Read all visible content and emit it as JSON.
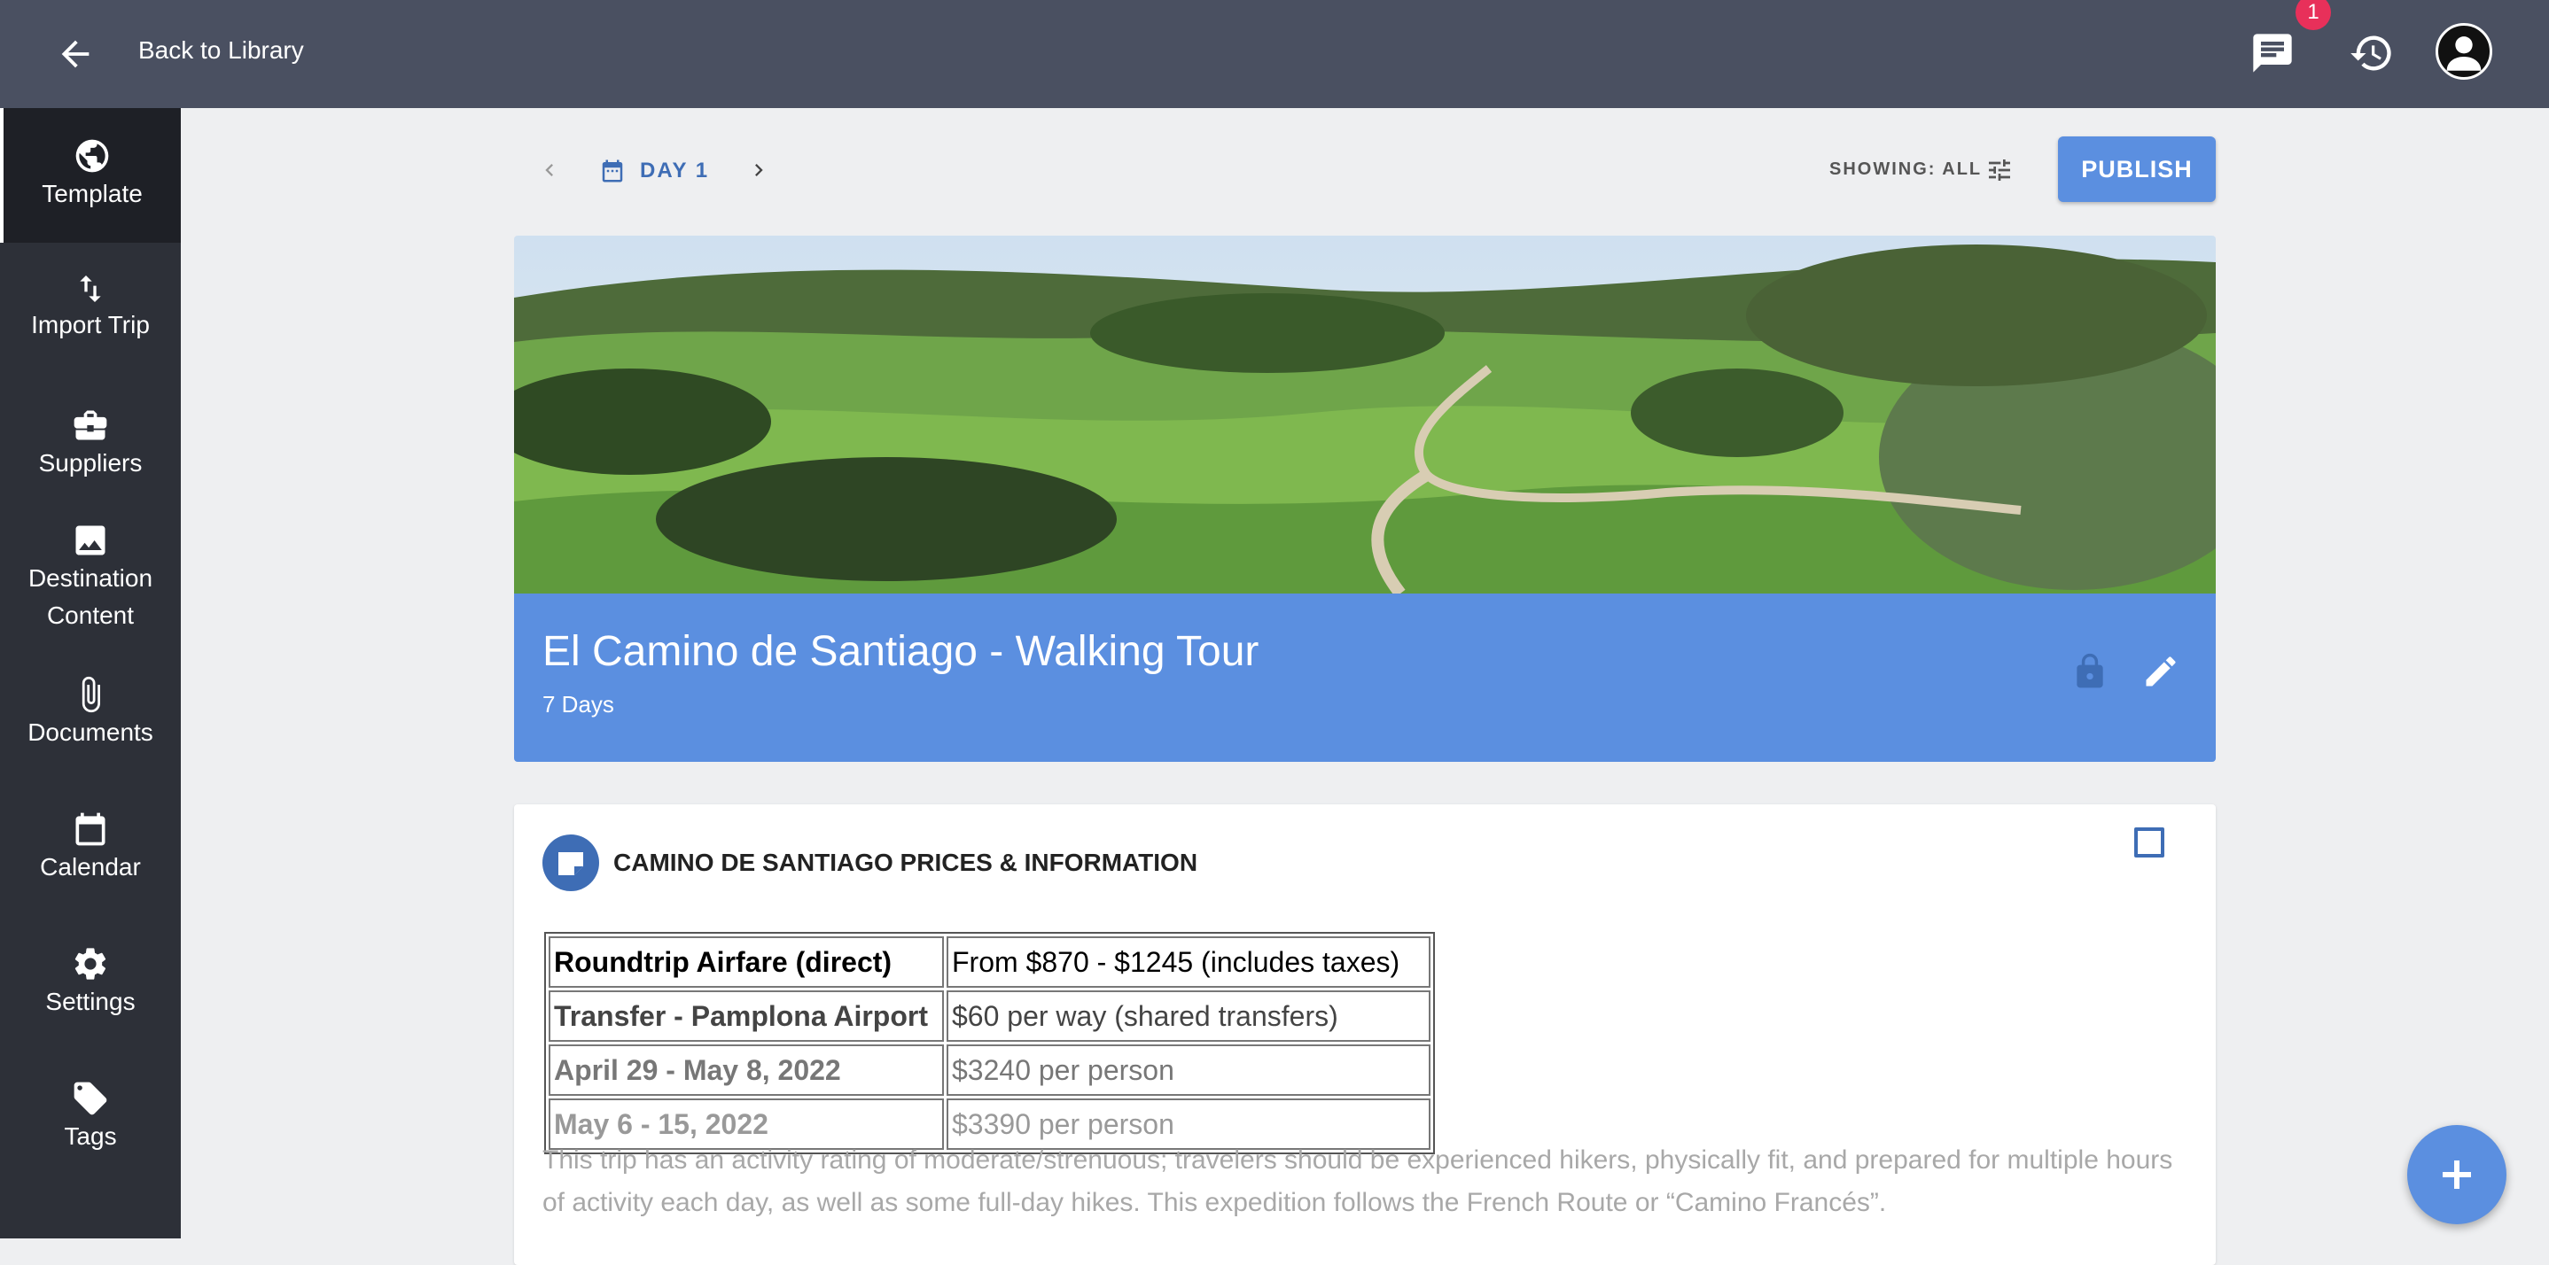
{
  "topbar": {
    "back_label": "Back to Library",
    "notification_count": "1"
  },
  "sidebar": {
    "items": [
      {
        "label": "Template",
        "icon": "globe-icon"
      },
      {
        "label": "Import Trip",
        "icon": "import-icon"
      },
      {
        "label": "Suppliers",
        "icon": "briefcase-icon"
      },
      {
        "label": "Destination",
        "label2": "Content",
        "icon": "image-icon"
      },
      {
        "label": "Documents",
        "icon": "paperclip-icon"
      },
      {
        "label": "Calendar",
        "icon": "calendar-icon"
      },
      {
        "label": "Settings",
        "icon": "gear-icon"
      },
      {
        "label": "Tags",
        "icon": "tag-icon"
      }
    ]
  },
  "toolbar": {
    "day_label": "DAY 1",
    "showing_label": "SHOWING: ALL",
    "publish_label": "PUBLISH"
  },
  "hero": {
    "title": "El Camino de Santiago - Walking Tour",
    "duration": "7 Days"
  },
  "card": {
    "title": "CAMINO DE SANTIAGO PRICES & INFORMATION",
    "table": [
      [
        "Roundtrip Airfare (direct)",
        "From $870 - $1245 (includes taxes)"
      ],
      [
        "Transfer - Pamplona Airport",
        "$60 per way (shared transfers)"
      ],
      [
        "April 29 - May 8, 2022",
        "$3240 per person"
      ],
      [
        "May 6 - 15, 2022",
        "$3390 per person"
      ]
    ],
    "description": "This trip has an activity rating of moderate/strenuous; travelers should be experienced hikers, physically fit, and prepared for multiple hours of activity each day, as well as some full-day hikes. This expedition follows the French Route or “Camino Francés”."
  },
  "colors": {
    "topbar": "#4a5061",
    "sidebar": "#2d3038",
    "accent": "#5b8fe0",
    "accent_dark": "#3e6db5",
    "badge": "#e8305a"
  }
}
